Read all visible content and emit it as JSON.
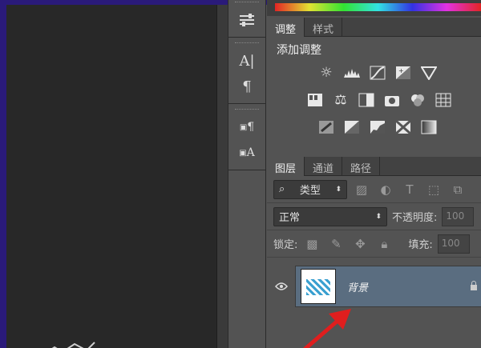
{
  "adjustments_panel": {
    "tabs": [
      "调整",
      "样式"
    ],
    "title": "添加调整",
    "icons_row1": [
      "brightness-icon",
      "levels-icon",
      "curves-icon",
      "exposure-icon",
      "vibrance-icon"
    ],
    "icons_row2": [
      "hue-saturation-icon",
      "color-balance-icon",
      "black-white-icon",
      "photo-filter-icon",
      "channel-mixer-icon",
      "color-lookup-icon"
    ],
    "icons_row3": [
      "invert-icon",
      "posterize-icon",
      "threshold-icon",
      "selective-color-icon",
      "gradient-map-icon"
    ]
  },
  "layers_panel": {
    "tabs": [
      "图层",
      "通道",
      "路径"
    ],
    "filter_kind": "类型",
    "blend_mode": "正常",
    "opacity_label": "不透明度:",
    "opacity_value": "100",
    "lock_label": "锁定:",
    "fill_label": "填充:",
    "fill_value": "100",
    "layers": [
      {
        "name": "背景"
      }
    ]
  },
  "iconcol": {
    "text_tool_glyph": "A|",
    "paragraph_glyph": "¶",
    "char_style_glyph": "A",
    "para_style_glyph": "¶"
  },
  "colors": {
    "panel_bg": "#535353",
    "canvas_bg": "#282828",
    "selected_layer": "#5a6d80",
    "annotation_arrow": "#e01e1e"
  }
}
